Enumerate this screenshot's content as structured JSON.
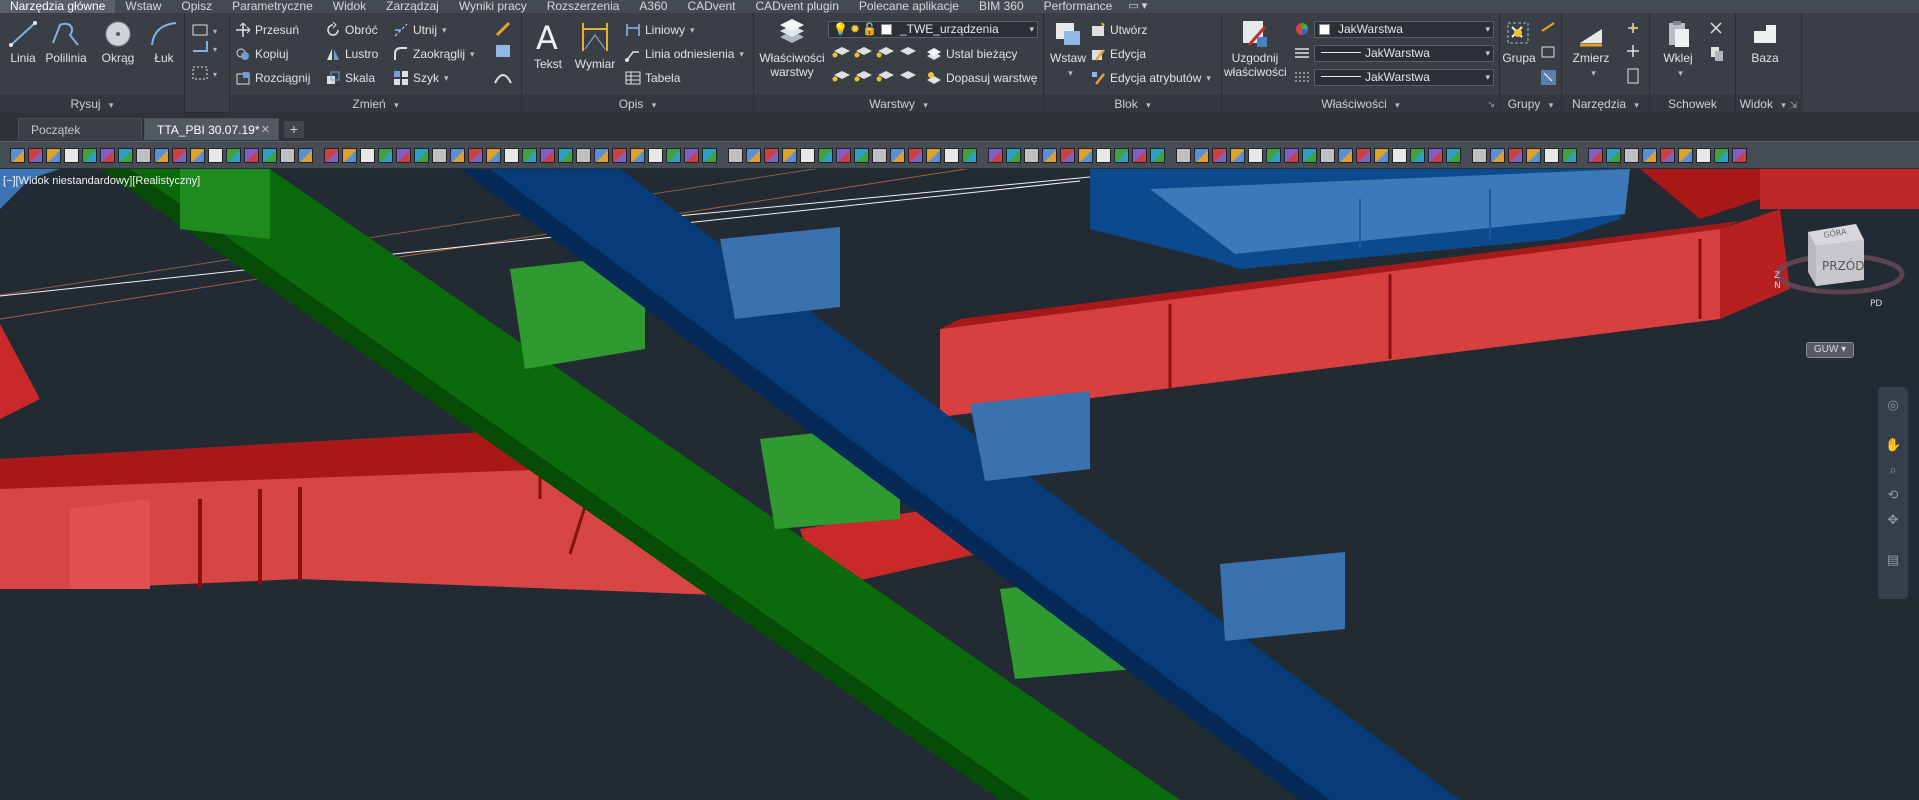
{
  "menu": {
    "tabs": [
      "Narzędzia główne",
      "Wstaw",
      "Opisz",
      "Parametryczne",
      "Widok",
      "Zarządzaj",
      "Wyniki pracy",
      "Rozszerzenia",
      "A360",
      "CADvent",
      "CADvent plugin",
      "Polecane aplikacje",
      "BIM 360",
      "Performance"
    ],
    "active_tab": "Narzędzia główne",
    "extra": "▭ ▾"
  },
  "ribbon": {
    "rysuj": {
      "title": "Rysuj",
      "linia": "Linia",
      "polilinia": "Polilinia",
      "okrag": "Okrąg",
      "luk": "Łuk"
    },
    "zmien": {
      "title": "Zmień",
      "przesun": "Przesuń",
      "obroc": "Obróć",
      "utnij": "Utnij",
      "kopiuj": "Kopiuj",
      "lustro": "Lustro",
      "zaokraglij": "Zaokrąglij",
      "rozciagnij": "Rozciągnij",
      "skala": "Skala",
      "szyk": "Szyk"
    },
    "opis": {
      "title": "Opis",
      "tekst": "Tekst",
      "wymiar": "Wymiar",
      "liniowy": "Liniowy",
      "linia_odniesienia": "Linia odniesienia",
      "tabela": "Tabela"
    },
    "warstwy": {
      "title": "Warstwy",
      "wlasciwosci_1": "Właściwości",
      "wlasciwosci_2": "warstwy",
      "layer_combo": "_TWE_urządzenia",
      "ustal_biezacy": "Ustal bieżący",
      "dopasuj_warstwe": "Dopasuj warstwę"
    },
    "blok": {
      "title": "Blok",
      "wstaw": "Wstaw",
      "utworz": "Utwórz",
      "edycja": "Edycja",
      "edycja_atrybutow": "Edycja atrybutów"
    },
    "wlasciwosci": {
      "title": "Właściwości",
      "uzgodnij_1": "Uzgodnij",
      "uzgodnij_2": "właściwości",
      "color": "JakWarstwa",
      "linetype": "JakWarstwa",
      "lineweight": "JakWarstwa"
    },
    "grupy": {
      "title": "Grupy",
      "grupa": "Grupa"
    },
    "narzedzia": {
      "title": "Narzędzia",
      "zmierz": "Zmierz"
    },
    "schowek": {
      "title": "Schowek",
      "wklej": "Wklej"
    },
    "widok": {
      "title": "Widok",
      "baza": "Baza"
    }
  },
  "doc_tabs": [
    {
      "label": "Początek"
    },
    {
      "label": "TTA_PBI 30.07.19*",
      "close": "✕"
    }
  ],
  "add_tab": "+",
  "viewport": {
    "label": "[−][Widok niestandardowy][Realistyczny]",
    "viewcube": {
      "face": "PRZÓD",
      "top": "GÓRA",
      "compass_z": "Z",
      "compass_n": "N",
      "compass_pd": "PD"
    },
    "wcs_badge": "GUW ▾"
  },
  "colors": {
    "accent": "#4a90d9",
    "duct_red": "#d83a3a",
    "duct_green": "#0c6a0c",
    "duct_blue": "#073c78",
    "duct_lightblue": "#3a72b0",
    "background": "#222a33"
  }
}
